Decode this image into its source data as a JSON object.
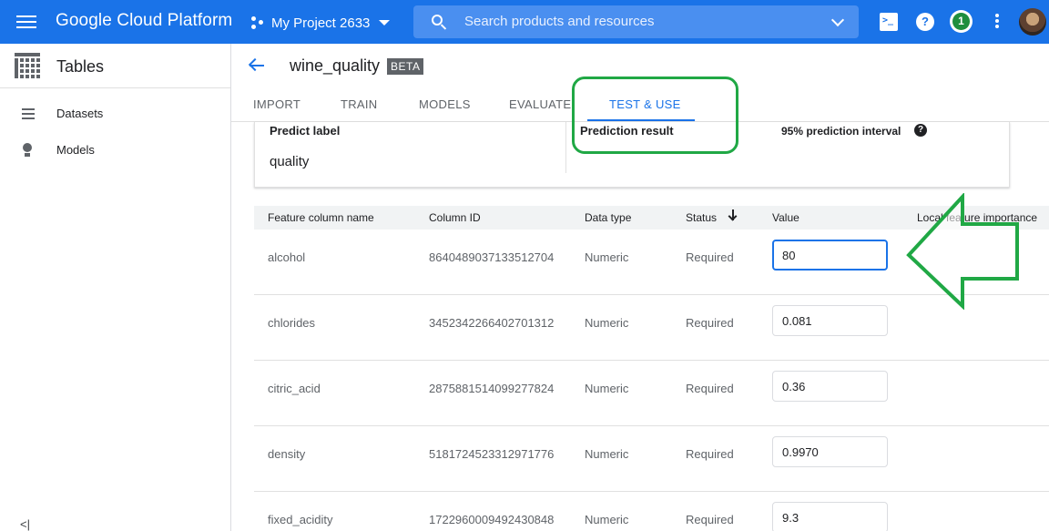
{
  "topbar": {
    "brand": "Google Cloud Platform",
    "project": "My Project 2633",
    "search_placeholder": "Search products and resources",
    "notification_count": "1",
    "color": "#1a73e8"
  },
  "sidebar": {
    "title": "Tables",
    "items": [
      {
        "label": "Datasets",
        "icon": "list-icon"
      },
      {
        "label": "Models",
        "icon": "lightbulb-icon"
      }
    ],
    "collapse_glyph": "<|"
  },
  "header": {
    "dataset_name": "wine_quality",
    "badge": "BETA"
  },
  "tabs": [
    {
      "label": "IMPORT",
      "active": false
    },
    {
      "label": "TRAIN",
      "active": false
    },
    {
      "label": "MODELS",
      "active": false
    },
    {
      "label": "EVALUATE",
      "active": false
    },
    {
      "label": "TEST & USE",
      "active": true
    }
  ],
  "prediction": {
    "predict_label_header": "Predict label",
    "predict_label_value": "quality",
    "result_header": "Prediction result",
    "interval_header": "95% prediction interval"
  },
  "table": {
    "headers": {
      "feature": "Feature column name",
      "column_id": "Column ID",
      "data_type": "Data type",
      "status": "Status",
      "value": "Value",
      "importance": "Local feature importance"
    },
    "rows": [
      {
        "feature": "alcohol",
        "column_id": "8640489037133512704",
        "data_type": "Numeric",
        "status": "Required",
        "value": "80"
      },
      {
        "feature": "chlorides",
        "column_id": "3452342266402701312",
        "data_type": "Numeric",
        "status": "Required",
        "value": "0.081"
      },
      {
        "feature": "citric_acid",
        "column_id": "2875881514099277824",
        "data_type": "Numeric",
        "status": "Required",
        "value": "0.36"
      },
      {
        "feature": "density",
        "column_id": "5181724523312971776",
        "data_type": "Numeric",
        "status": "Required",
        "value": "0.9970"
      },
      {
        "feature": "fixed_acidity",
        "column_id": "1722960009492430848",
        "data_type": "Numeric",
        "status": "Required",
        "value": "9.3"
      }
    ]
  },
  "annotation_color": "#20a845"
}
